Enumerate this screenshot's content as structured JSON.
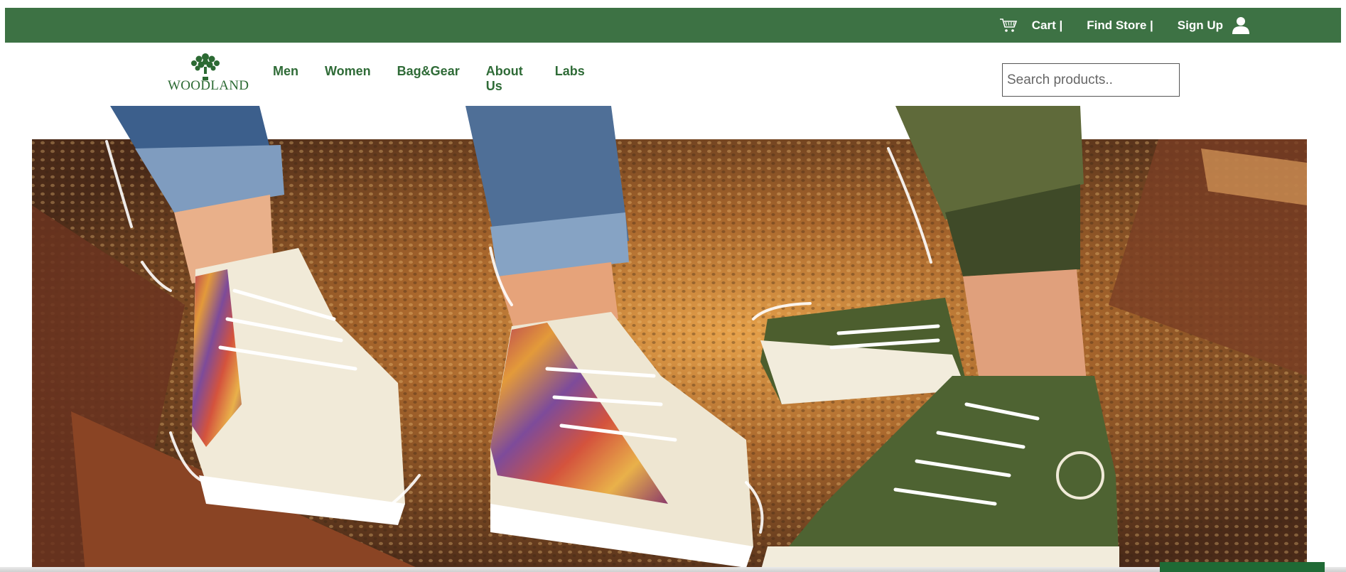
{
  "topbar": {
    "cart_label": "Cart |",
    "find_store_label": "Find Store |",
    "signup_label": "Sign Up",
    "cart_icon": "cart-icon",
    "user_icon": "user-icon",
    "bg_color": "#3d7244"
  },
  "nav": {
    "logo_text": "WOODLAND",
    "items": [
      "Men",
      "Women",
      "Bag&Gear",
      "About Us",
      "Labs"
    ],
    "about_line1": "About",
    "about_line2": "Us"
  },
  "search": {
    "placeholder": "Search products.."
  },
  "hero": {
    "image_subject": "three people wearing Woodland canvas high-top sneakers on gravel"
  },
  "colors": {
    "brand_green": "#3d7244",
    "nav_text": "#2f6b37"
  }
}
